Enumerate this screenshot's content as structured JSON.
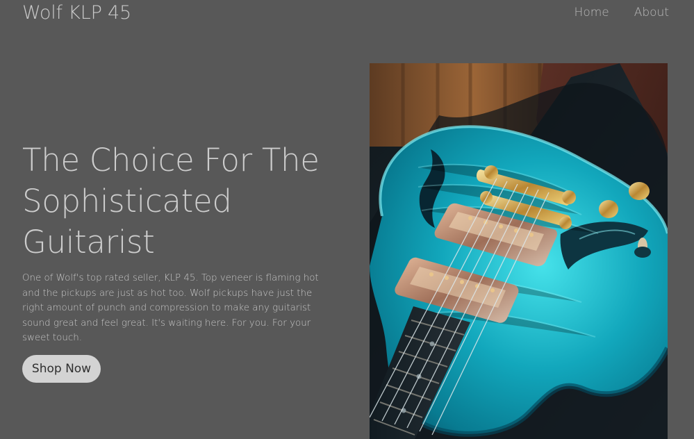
{
  "header": {
    "brand": "Wolf KLP 45",
    "nav": [
      {
        "label": "Home"
      },
      {
        "label": "About"
      }
    ]
  },
  "hero": {
    "title": "The Choice For The Sophisticated Guitarist",
    "description": "One of Wolf's top rated seller, KLP 45. Top veneer is flaming hot and the pickups are just as hot too. Wolf pickups have just the right amount of punch and compression to make any guitarist sound great and feel great. It's waiting here. For you. For your sweet touch.",
    "cta_label": "Shop Now"
  },
  "colors": {
    "background": "#585858",
    "text": "#cdcdcd",
    "button": "#d3d3d3",
    "guitar_body": "#1ea3b2"
  },
  "image": {
    "subject": "guitar-photo"
  }
}
